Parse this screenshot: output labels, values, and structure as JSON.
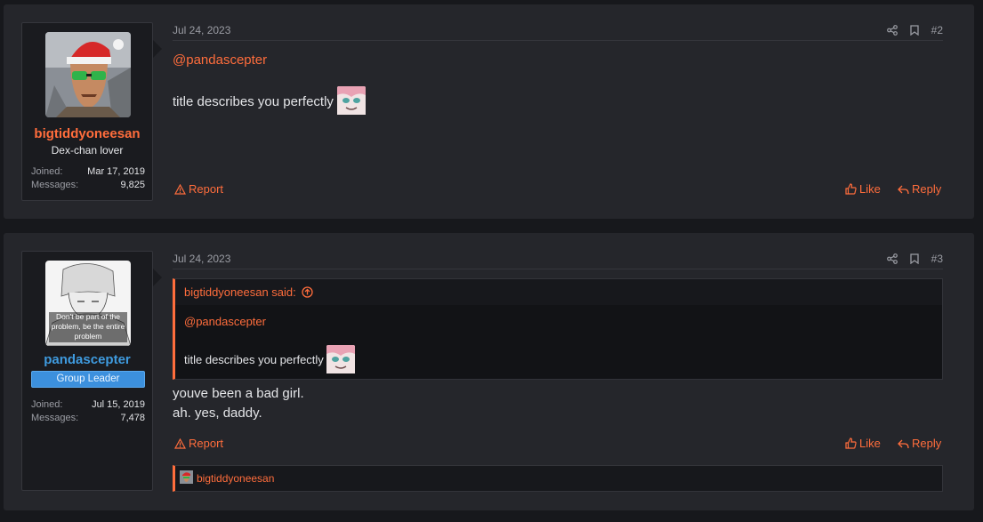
{
  "posts": [
    {
      "username": "bigtiddyoneesan",
      "user_title": "Dex-chan lover",
      "joined_label": "Joined:",
      "joined": "Mar 17, 2019",
      "messages_label": "Messages:",
      "messages": "9,825",
      "date": "Jul 24, 2023",
      "number": "#2",
      "mention": "@pandascepter",
      "text": "title describes you perfectly",
      "report": "Report",
      "like": "Like",
      "reply": "Reply"
    },
    {
      "username": "pandascepter",
      "badge": "Group Leader",
      "joined_label": "Joined:",
      "joined": "Jul 15, 2019",
      "messages_label": "Messages:",
      "messages": "7,478",
      "date": "Jul 24, 2023",
      "number": "#3",
      "quote_author": "bigtiddyoneesan said:",
      "quote_mention": "@pandascepter",
      "quote_text": "title describes you perfectly",
      "line1": "youve been a bad girl.",
      "line2": "ah. yes, daddy.",
      "report": "Report",
      "like": "Like",
      "reply": "Reply",
      "reaction_user": "bigtiddyoneesan",
      "avatar_caption": "Don't be part of the problem, be the entire problem"
    }
  ],
  "colors": {
    "accent": "#ff6d3c",
    "username_blue": "#3f9bdf",
    "badge": "#3c90dd",
    "background": "#17181c",
    "panel": "#25262b"
  },
  "icons": [
    "share-icon",
    "bookmark-icon",
    "warning-icon",
    "thumbs-up-icon",
    "reply-icon",
    "arrow-up-circle-icon"
  ]
}
